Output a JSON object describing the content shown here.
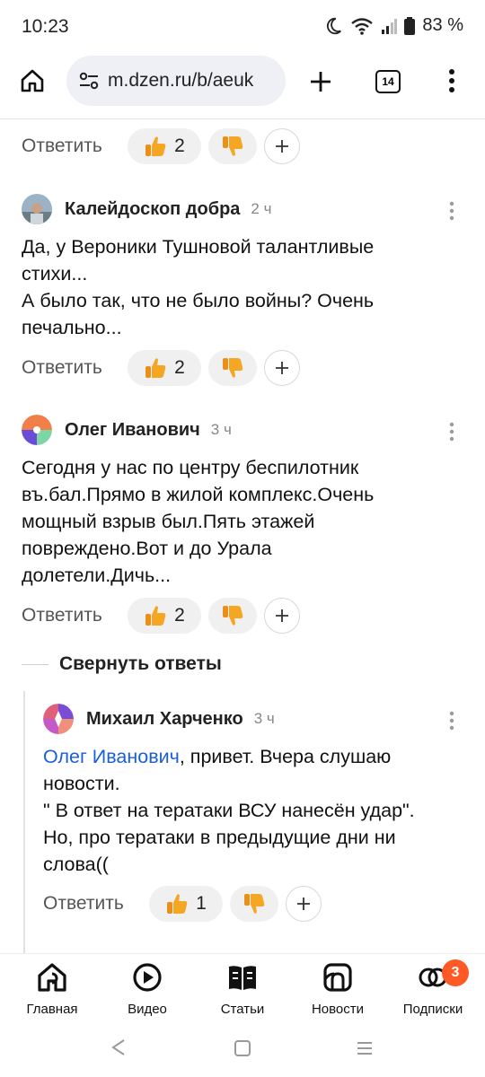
{
  "status_bar": {
    "time": "10:23",
    "battery": "83 %"
  },
  "browser": {
    "url": "m.dzen.ru/b/aeuk",
    "tab_count": "14"
  },
  "top_actions": {
    "reply": "Ответить",
    "likes": "2"
  },
  "comments": [
    {
      "author": "Калейдоскоп добра",
      "ago": "2 ч",
      "lines": [
        "Да, у Вероники Тушновой талантливые",
        "стихи...",
        "А было так, что не было войны? Очень",
        "печально..."
      ],
      "reply": "Ответить",
      "likes": "2"
    },
    {
      "author": "Олег Иванович",
      "ago": "3 ч",
      "lines": [
        "Сегодня у нас по центру беспилотник",
        "въ.бал.Прямо в жилой комплекс.Очень",
        "мощный взрыв был.Пять этажей",
        "повреждено.Вот и до Урала",
        "долетели.Дичь..."
      ],
      "reply": "Ответить",
      "likes": "2"
    }
  ],
  "collapse_label": "Свернуть ответы",
  "reply_comment": {
    "author": "Михаил Харченко",
    "ago": "3 ч",
    "mention": "Олег Иванович",
    "first_line_rest": ", привет. Вчера слушаю",
    "lines": [
      "новости.",
      "\" В ответ на тератаки ВСУ нанесён удар\".",
      "Но, про тератаки в предыдущие дни ни",
      "слова(("
    ],
    "reply": "Ответить",
    "likes": "1"
  },
  "bottom_nav": [
    {
      "label": "Главная",
      "icon": "home-icon"
    },
    {
      "label": "Видео",
      "icon": "video-icon"
    },
    {
      "label": "Статьи",
      "icon": "articles-icon"
    },
    {
      "label": "Новости",
      "icon": "news-icon"
    },
    {
      "label": "Подписки",
      "icon": "subscriptions-icon",
      "badge": "3"
    }
  ],
  "colors": {
    "link": "#1a5fd6",
    "badge": "#ff5a26",
    "like_hand": "#f5a623"
  }
}
